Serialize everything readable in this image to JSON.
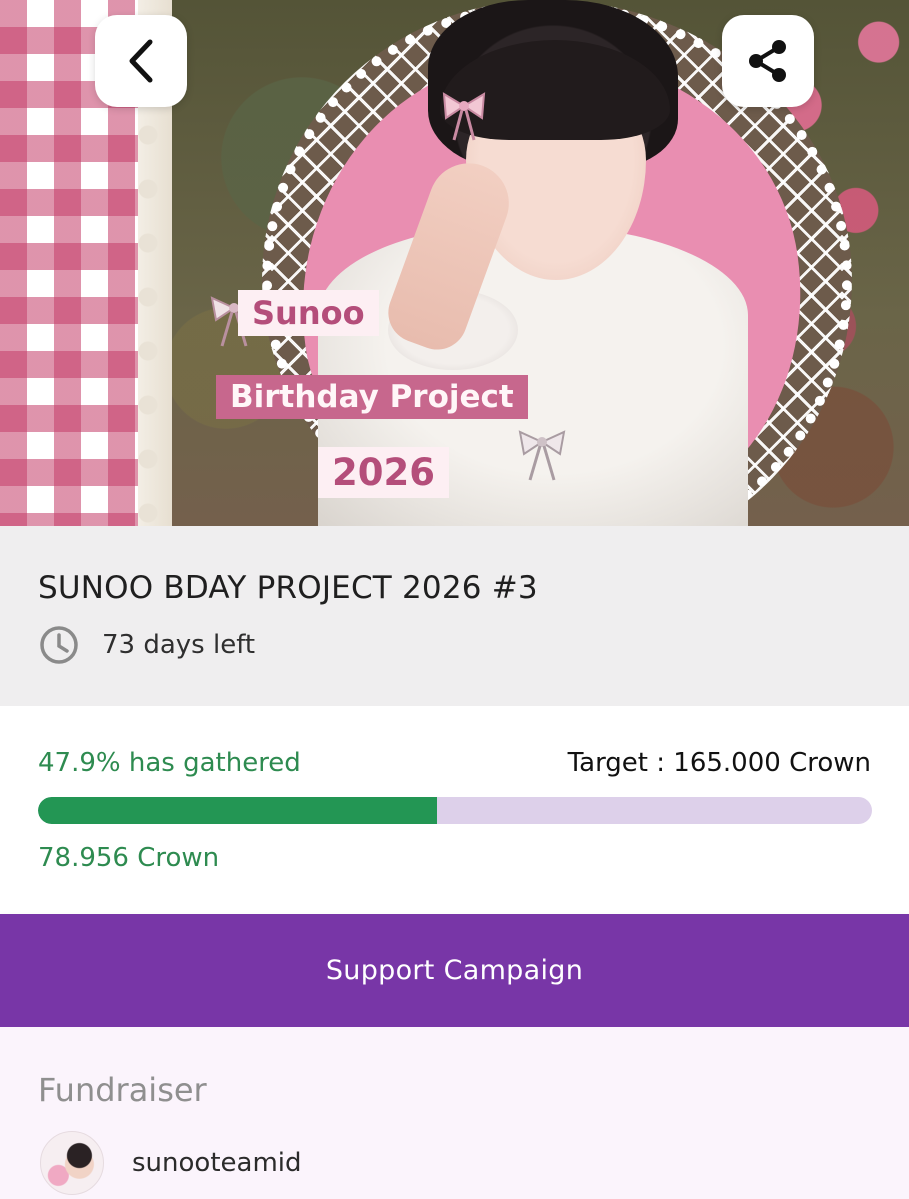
{
  "hero": {
    "banner_line_1": "Sunoo",
    "banner_line_2": "Birthday Project",
    "banner_line_3": "2026",
    "back_icon": "chevron-left-icon",
    "share_icon": "share-icon"
  },
  "campaign": {
    "title": "SUNOO BDAY PROJECT 2026 #3",
    "days_left": "73 days left",
    "clock_icon": "clock-icon"
  },
  "progress": {
    "gathered_label": "47.9% has gathered",
    "target_label": "Target : 165.000 Crown",
    "collected_label": "78.956 Crown",
    "fraction": 0.479,
    "fill_color": "#239654",
    "track_color": "#ddd0ea"
  },
  "actions": {
    "support_label": "Support Campaign",
    "support_color": "#7836a7"
  },
  "fundraiser": {
    "heading": "Fundraiser",
    "name": "sunooteamid"
  }
}
